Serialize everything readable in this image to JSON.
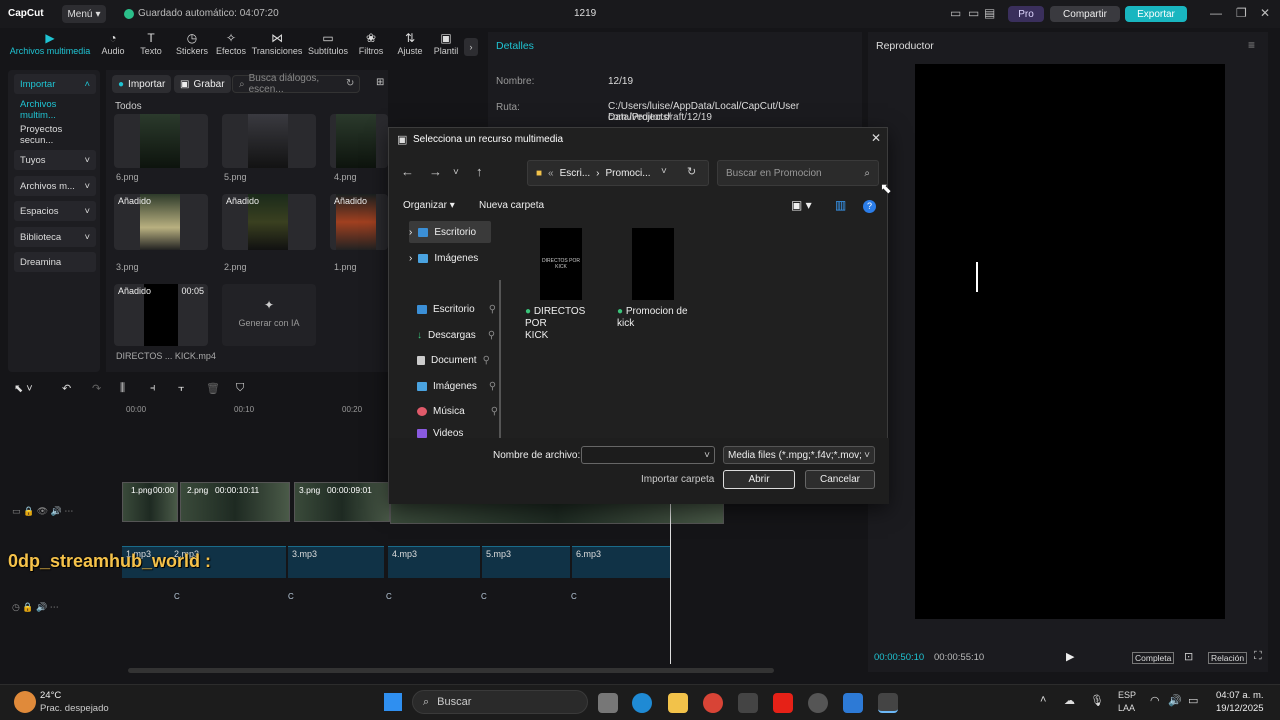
{
  "titlebar": {
    "logo": "CapCut",
    "menu": "Menú",
    "autosave": "Guardado automático: 04:07:20",
    "project_title": "1219",
    "pro": "Pro",
    "share": "Compartir",
    "export": "Exportar"
  },
  "toolbar": {
    "items": [
      {
        "label": "Archivos multimedia",
        "icon": "media-icon"
      },
      {
        "label": "Audio",
        "icon": "audio-icon"
      },
      {
        "label": "Texto",
        "icon": "text-icon"
      },
      {
        "label": "Stickers",
        "icon": "sticker-icon"
      },
      {
        "label": "Efectos",
        "icon": "effects-icon"
      },
      {
        "label": "Transiciones",
        "icon": "transitions-icon"
      },
      {
        "label": "Subtítulos",
        "icon": "subtitles-icon"
      },
      {
        "label": "Filtros",
        "icon": "filters-icon"
      },
      {
        "label": "Ajuste",
        "icon": "adjust-icon"
      },
      {
        "label": "Plantil",
        "icon": "template-icon"
      }
    ]
  },
  "leftnav": {
    "items": [
      "Importar",
      "Archivos multim...",
      "Proyectos secun...",
      "Tuyos",
      "Archivos m...",
      "Espacios",
      "Biblioteca",
      "Dreamina"
    ]
  },
  "media": {
    "import_btn": "Importar",
    "record_btn": "Grabar",
    "search_placeholder": "Busca diálogos, escen...",
    "section": "Todos",
    "added": "Añadido",
    "items": [
      "6.png",
      "5.png",
      "4.png",
      "3.png",
      "2.png",
      "1.png",
      "DIRECTOS ... KICK.mp4"
    ],
    "video_duration": "00:05",
    "generate_ai": "Generar con IA"
  },
  "details": {
    "title": "Detalles",
    "name_label": "Nombre:",
    "name_value": "12/19",
    "path_label": "Ruta:",
    "path_value_1": "C:/Users/luise/AppData/Local/CapCut/User Data/Projects/",
    "path_value_2": "com.lveditor.draft/12/19"
  },
  "player": {
    "title": "Reproductor",
    "time_current": "00:00:50:10",
    "time_total": "00:00:55:10",
    "full": "Completa",
    "ratio": "Relación"
  },
  "timeline": {
    "ruler": [
      "00:00",
      "00:10",
      "00:20"
    ],
    "clips": [
      {
        "label": "1.png",
        "time": "00:00"
      },
      {
        "label": "2.png",
        "time": "00:00:10:11"
      },
      {
        "label": "3.png",
        "time": "00:00:09:01"
      }
    ],
    "audio": [
      "1.mp3",
      "2.mp3",
      "3.mp3",
      "4.mp3",
      "5.mp3",
      "6.mp3"
    ],
    "marker": "C",
    "overlay": "0dp_streamhub_world :"
  },
  "dialog": {
    "title": "Selecciona un recurso multimedia",
    "breadcrumb_1": "Escri...",
    "breadcrumb_2": "Promoci...",
    "search_placeholder": "Buscar en Promocion",
    "organize": "Organizar",
    "new_folder": "Nueva carpeta",
    "tree_top": [
      "Escritorio",
      "Imágenes"
    ],
    "tree_quick": [
      "Escritorio",
      "Descargas",
      "Document",
      "Imágenes",
      "Música",
      "Videos"
    ],
    "files": [
      {
        "name_1": "DIRECTOS POR",
        "name_2": "KICK",
        "preview": "DIRECTOS POR KICK"
      },
      {
        "name_1": "Promocion de",
        "name_2": "kick",
        "preview": ""
      }
    ],
    "filename_label": "Nombre de archivo:",
    "filename_value": "",
    "filter": "Media files (*.mpg;*.f4v;*.mov;",
    "import_folder": "Importar carpeta",
    "open": "Abrir",
    "cancel": "Cancelar"
  },
  "taskbar": {
    "temp": "24°C",
    "weather": "Prac. despejado",
    "search": "Buscar",
    "lang_1": "ESP",
    "lang_2": "LAA",
    "time": "04:07 a. m.",
    "date": "19/12/2025"
  }
}
